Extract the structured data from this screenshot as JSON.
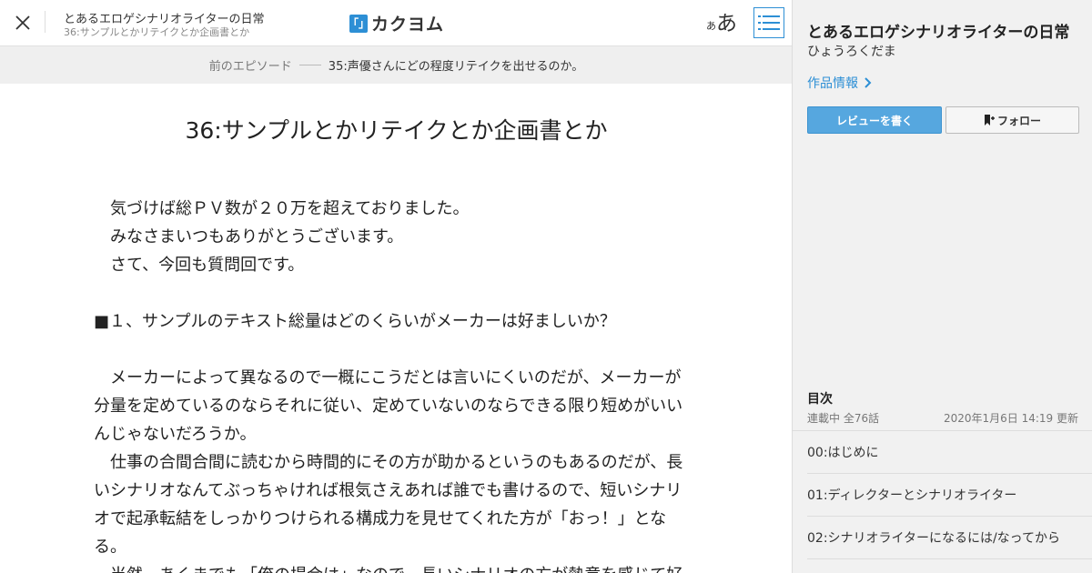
{
  "header": {
    "work_title": "とあるエロゲシナリオライターの日常",
    "episode_title": "36:サンプルとかリテイクとか企画書とか",
    "logo_text": "カクヨム",
    "font_size_small": "あ",
    "font_size_large": "あ"
  },
  "prev_episode": {
    "label": "前のエピソード",
    "title": "35:声優さんにどの程度リテイクを出せるのか。"
  },
  "episode": {
    "title": "36:サンプルとかリテイクとか企画書とか",
    "paragraphs": [
      "　気づけば総ＰＶ数が２０万を超えておりました。",
      "　みなさまいつもありがとうございます。",
      "　さて、今回も質問回です。",
      "",
      "■１、サンプルのテキスト総量はどのくらいがメーカーは好ましいか？",
      "",
      "　メーカーによって異なるので一概にこうだとは言いにくいのだが、メーカーが分量を定めているのならそれに従い、定めていないのならできる限り短めがいいんじゃないだろうか。",
      "　仕事の合間合間に読むから時間的にその方が助かるというのもあるのだが、長いシナリオなんてぶっちゃければ根気さえあれば誰でも書けるので、短いシナリオで起承転結をしっかりつけられる構成力を見せてくれた方が「おっ！」となる。",
      "　当然、あくまでも「俺の場合は」なので、長いシナリオの方が熱意を感じて好"
    ]
  },
  "sidebar": {
    "work_title": "とあるエロゲシナリオライターの日常",
    "author": "ひょうろくだま",
    "info_link": "作品情報",
    "review_button": "レビューを書く",
    "follow_button": "フォロー",
    "toc": {
      "heading": "目次",
      "status": "連載中 全76話",
      "updated": "2020年1月6日 14:19 更新",
      "items": [
        "00:はじめに",
        "01:ディレクターとシナリオライター",
        "02:シナリオライターになるには/なってから"
      ]
    }
  },
  "colors": {
    "accent": "#2d8fd5",
    "review_button": "#56a7df",
    "prev_nav_bg": "#efefef",
    "sidebar_bg": "#f1f1f1"
  },
  "icons": {
    "close": "close-icon",
    "toc": "list-icon",
    "chevron": "chevron-right-icon",
    "bookmark": "bookmark-plus-icon"
  }
}
